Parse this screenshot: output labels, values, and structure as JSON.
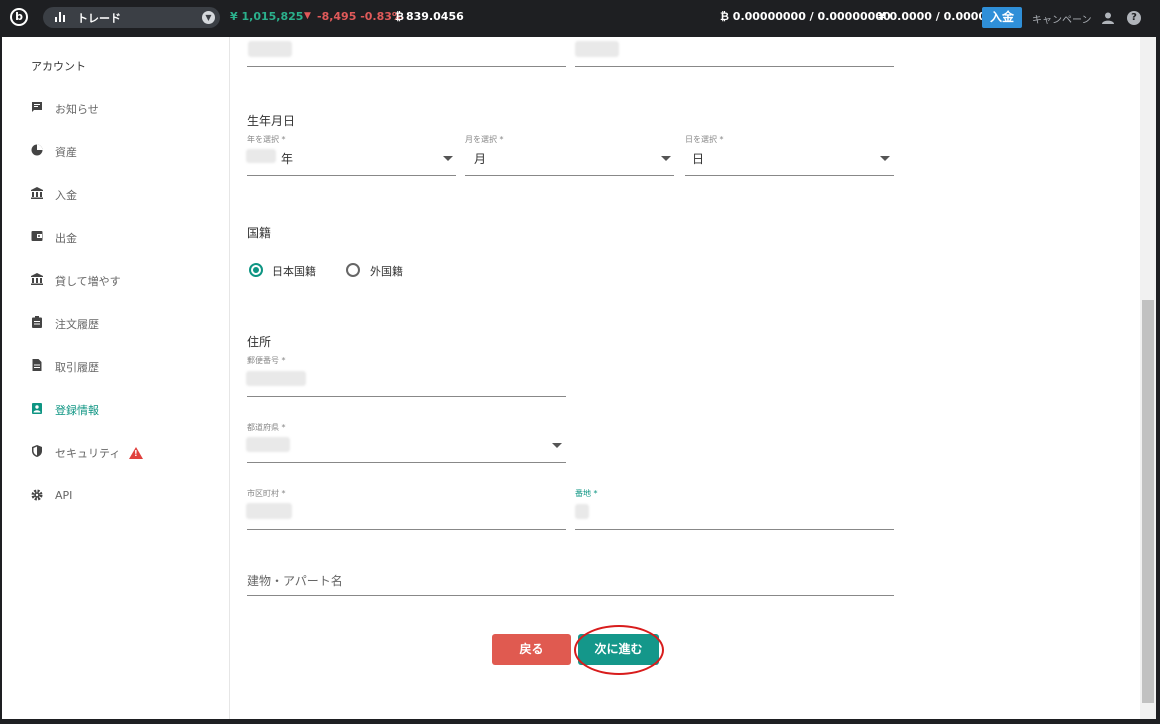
{
  "topbar": {
    "market_label": "トレード",
    "jpy_balance": "¥ 1,015,825",
    "change": "-8,495 -0.83%",
    "btc_price": "839.0456",
    "btc_symbol": "₿",
    "btc_balance": "₿ 0.00000000 / 0.00000000",
    "jpy_available": "¥ 0.0000 / 0.0000",
    "deposit_button": "入金",
    "campaign": "キャンペーン",
    "colors": {
      "positive": "#2bb08c",
      "negative": "#e05a5a",
      "deposit": "#2f8fd8"
    }
  },
  "sidebar": {
    "title": "アカウント",
    "items": [
      {
        "label": "お知らせ",
        "icon": "announcement-icon"
      },
      {
        "label": "資産",
        "icon": "pie-chart-icon"
      },
      {
        "label": "入金",
        "icon": "bank-icon"
      },
      {
        "label": "出金",
        "icon": "wallet-icon"
      },
      {
        "label": "貸して増やす",
        "icon": "bank-icon"
      },
      {
        "label": "注文履歴",
        "icon": "clipboard-icon"
      },
      {
        "label": "取引履歴",
        "icon": "document-icon"
      },
      {
        "label": "登録情報",
        "icon": "badge-icon",
        "active": true
      },
      {
        "label": "セキュリティ",
        "icon": "shield-icon",
        "warning": true
      },
      {
        "label": "API",
        "icon": "gear-icon"
      }
    ],
    "warning_symbol": "!"
  },
  "form": {
    "birth": {
      "heading": "生年月日",
      "year_label": "年を選択 *",
      "year_suffix": "年",
      "month_label": "月を選択 *",
      "month_value": "月",
      "day_label": "日を選択 *",
      "day_value": "日"
    },
    "nationality": {
      "heading": "国籍",
      "options": [
        "日本国籍",
        "外国籍"
      ],
      "selected": "日本国籍"
    },
    "address": {
      "heading": "住所",
      "postal_label": "郵便番号 *",
      "prefecture_label": "都道府県 *",
      "city_label": "市区町村 *",
      "street_label": "番地 *",
      "building_placeholder": "建物・アパート名"
    },
    "buttons": {
      "back": "戻る",
      "next": "次に進む"
    }
  }
}
